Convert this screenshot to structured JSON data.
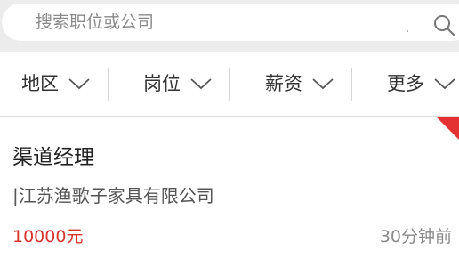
{
  "search": {
    "placeholder": "搜索职位或公司",
    "icon": "search-icon"
  },
  "filters": [
    {
      "label": "地区",
      "icon": "chevron-down-icon"
    },
    {
      "label": "岗位",
      "icon": "chevron-down-icon"
    },
    {
      "label": "薪资",
      "icon": "chevron-down-icon"
    },
    {
      "label": "更多",
      "icon": "chevron-down-icon"
    }
  ],
  "job": {
    "title": "渠道经理",
    "company": "|江苏渔歌子家具有限公司",
    "salary": "10000元",
    "posted": "30分钟前"
  },
  "colors": {
    "accent": "#e43131",
    "salary": "#d9342b",
    "background_bar": "#ececec"
  }
}
